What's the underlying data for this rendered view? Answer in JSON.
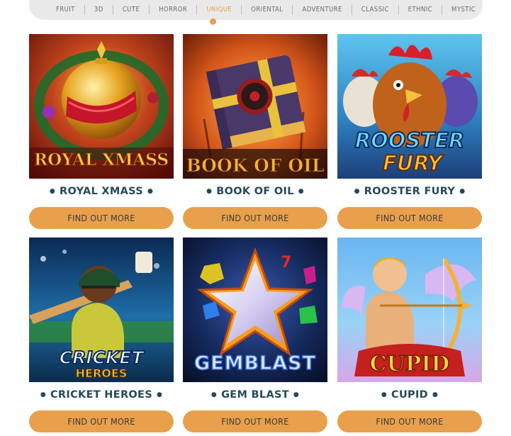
{
  "filters": {
    "items": [
      "FRUIT",
      "3D",
      "CUTE",
      "HORROR",
      "UNIQUE",
      "ORIENTAL",
      "ADVENTURE",
      "CLASSIC",
      "ETHNIC",
      "MYSTIC"
    ],
    "active": "UNIQUE"
  },
  "games": [
    {
      "title": "ROYAL XMASS",
      "logo": "ROYAL XMASS",
      "cta": "FIND OUT MORE"
    },
    {
      "title": "BOOK OF OIL",
      "logo": "BOOK OF OIL",
      "cta": "FIND OUT MORE"
    },
    {
      "title": "ROOSTER FURY",
      "logo_line1": "ROOSTER",
      "logo_line2": "FURY",
      "cta": "FIND OUT MORE"
    },
    {
      "title": "CRICKET HEROES",
      "logo_line1": "CRICKET",
      "logo_line2": "HEROES",
      "cta": "FIND OUT MORE"
    },
    {
      "title": "GEM BLAST",
      "logo": "GEMBLAST",
      "cta": "FIND OUT MORE"
    },
    {
      "title": "CUPID",
      "logo": "CUPID",
      "cta": "FIND OUT MORE"
    }
  ],
  "colors": {
    "accent": "#e8a04c",
    "title": "#244a5a",
    "filter_bar": "#e9e9e9"
  }
}
